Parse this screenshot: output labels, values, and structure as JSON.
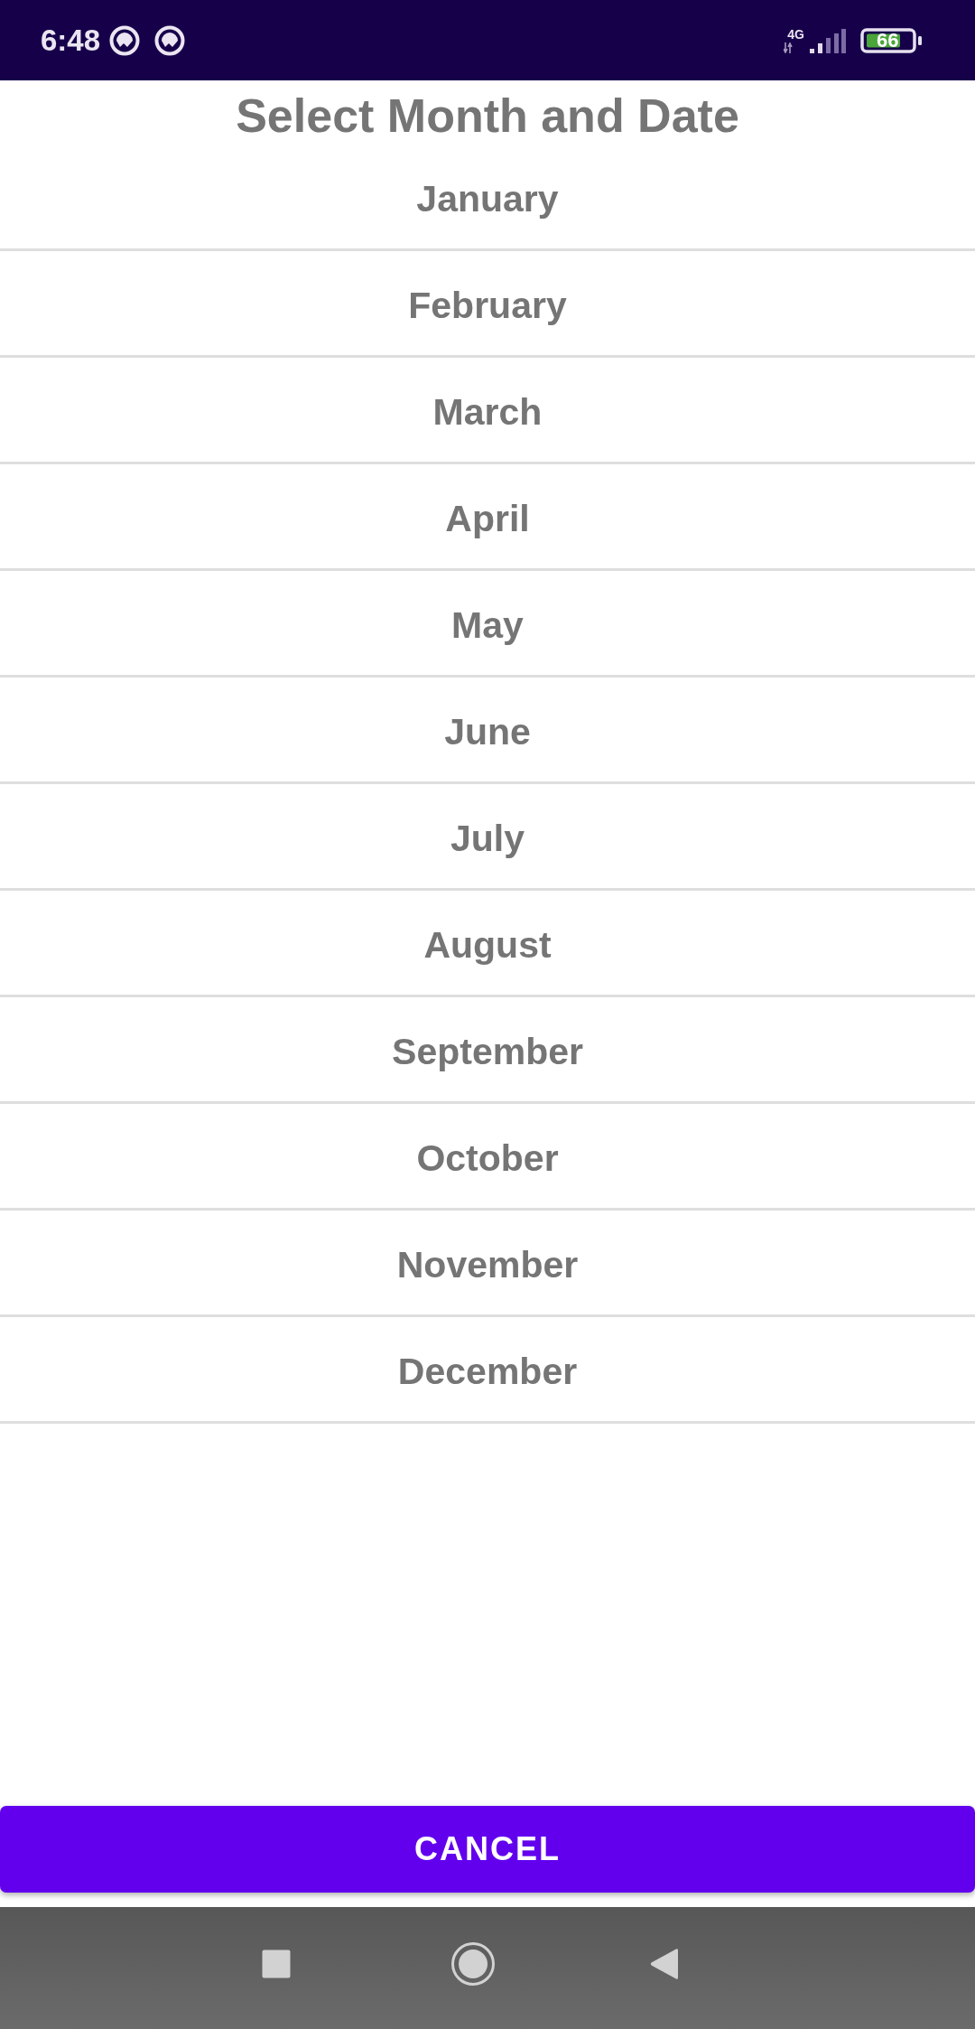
{
  "status_bar": {
    "time": "6:48",
    "network": "4G",
    "battery": "66"
  },
  "title": "Select Month and Date",
  "months": [
    "January",
    "February",
    "March",
    "April",
    "May",
    "June",
    "July",
    "August",
    "September",
    "October",
    "November",
    "December"
  ],
  "cancel_button": {
    "label": "CANCEL"
  }
}
